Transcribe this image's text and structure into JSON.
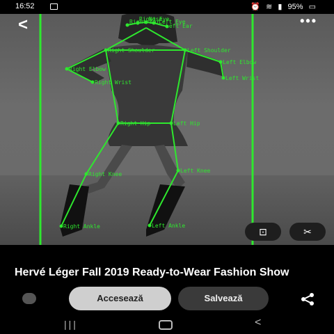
{
  "status_bar": {
    "time": "16:52",
    "battery": "95%",
    "icons": [
      "image-icon",
      "alarm-icon",
      "wifi-icon",
      "volte-icon",
      "signal-icon",
      "battery-icon"
    ]
  },
  "top_bar": {
    "back_icon": "chevron-left-icon",
    "more_icon": "more-horizontal-icon"
  },
  "pose_labels": {
    "right_eye": "Right Eye",
    "left_eye": "Left Eye",
    "nose": "Nose",
    "right_ear": "Right Ear",
    "left_ear": "Left Ear",
    "right_shoulder": "Right Shoulder",
    "left_shoulder": "Left Shoulder",
    "right_elbow": "Right Elbow",
    "left_elbow": "Left Elbow",
    "right_wrist": "Right Wrist",
    "left_wrist": "Left Wrist",
    "right_hip": "Right Hip",
    "left_hip": "Left Hip",
    "right_knee": "Right Knee",
    "left_knee": "Left Knee",
    "right_ankle": "Right Ankle",
    "left_ankle": "Left Ankle"
  },
  "overlay_color": "#2ee82e",
  "image_actions": {
    "lens_icon": "visual-search-icon",
    "cut_icon": "scissors-icon"
  },
  "pin": {
    "title": "Hervé Léger Fall 2019 Ready-to-Wear Fashion Show"
  },
  "actions": {
    "visit": "Accesează",
    "save": "Salvează"
  },
  "nav": {
    "recents": "|||",
    "back": "<"
  }
}
